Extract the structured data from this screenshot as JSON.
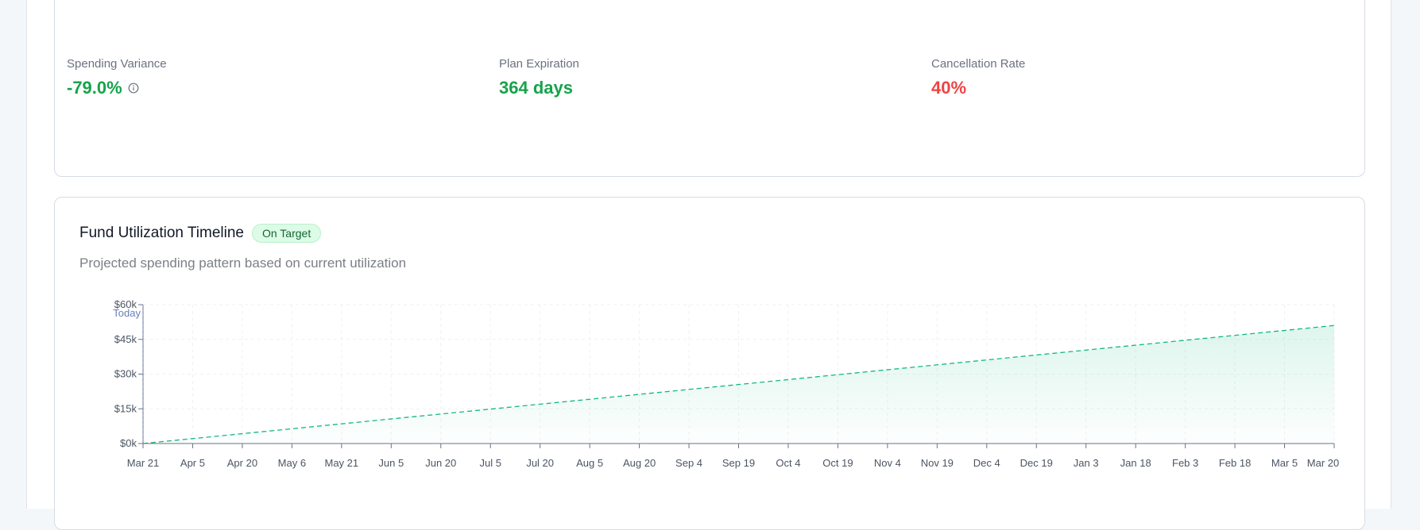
{
  "metrics": [
    {
      "label": "Spending Variance",
      "value": "-79.0%",
      "color": "#16a34a",
      "icon": "info-icon"
    },
    {
      "label": "Plan Expiration",
      "value": "364 days",
      "color": "#16a34a"
    },
    {
      "label": "Cancellation Rate",
      "value": "40%",
      "color": "#ef4444"
    }
  ],
  "chart_card": {
    "title": "Fund Utilization Timeline",
    "badge": "On Target",
    "subtitle": "Projected spending pattern based on current utilization"
  },
  "chart_data": {
    "type": "area",
    "x_ticks": [
      "Mar 21",
      "Apr 5",
      "Apr 20",
      "May 6",
      "May 21",
      "Jun 5",
      "Jun 20",
      "Jul 5",
      "Jul 20",
      "Aug 5",
      "Aug 20",
      "Sep 4",
      "Sep 19",
      "Oct 4",
      "Oct 19",
      "Nov 4",
      "Nov 19",
      "Dec 4",
      "Dec 19",
      "Jan 3",
      "Jan 18",
      "Feb 3",
      "Feb 18",
      "Mar 5",
      "Mar 20"
    ],
    "y_ticks": [
      "$0k",
      "$15k",
      "$30k",
      "$45k",
      "$60k"
    ],
    "y_tick_values": [
      0,
      15000,
      30000,
      45000,
      60000
    ],
    "ylim": [
      0,
      60000
    ],
    "series": [
      {
        "x": [
          "Mar 21",
          "Mar 20"
        ],
        "values": [
          0,
          51000
        ],
        "line_style": "dashed",
        "color": "#10b981"
      }
    ],
    "annotations": [
      {
        "label": "Today",
        "x": "Mar 21"
      }
    ],
    "grid": true
  }
}
